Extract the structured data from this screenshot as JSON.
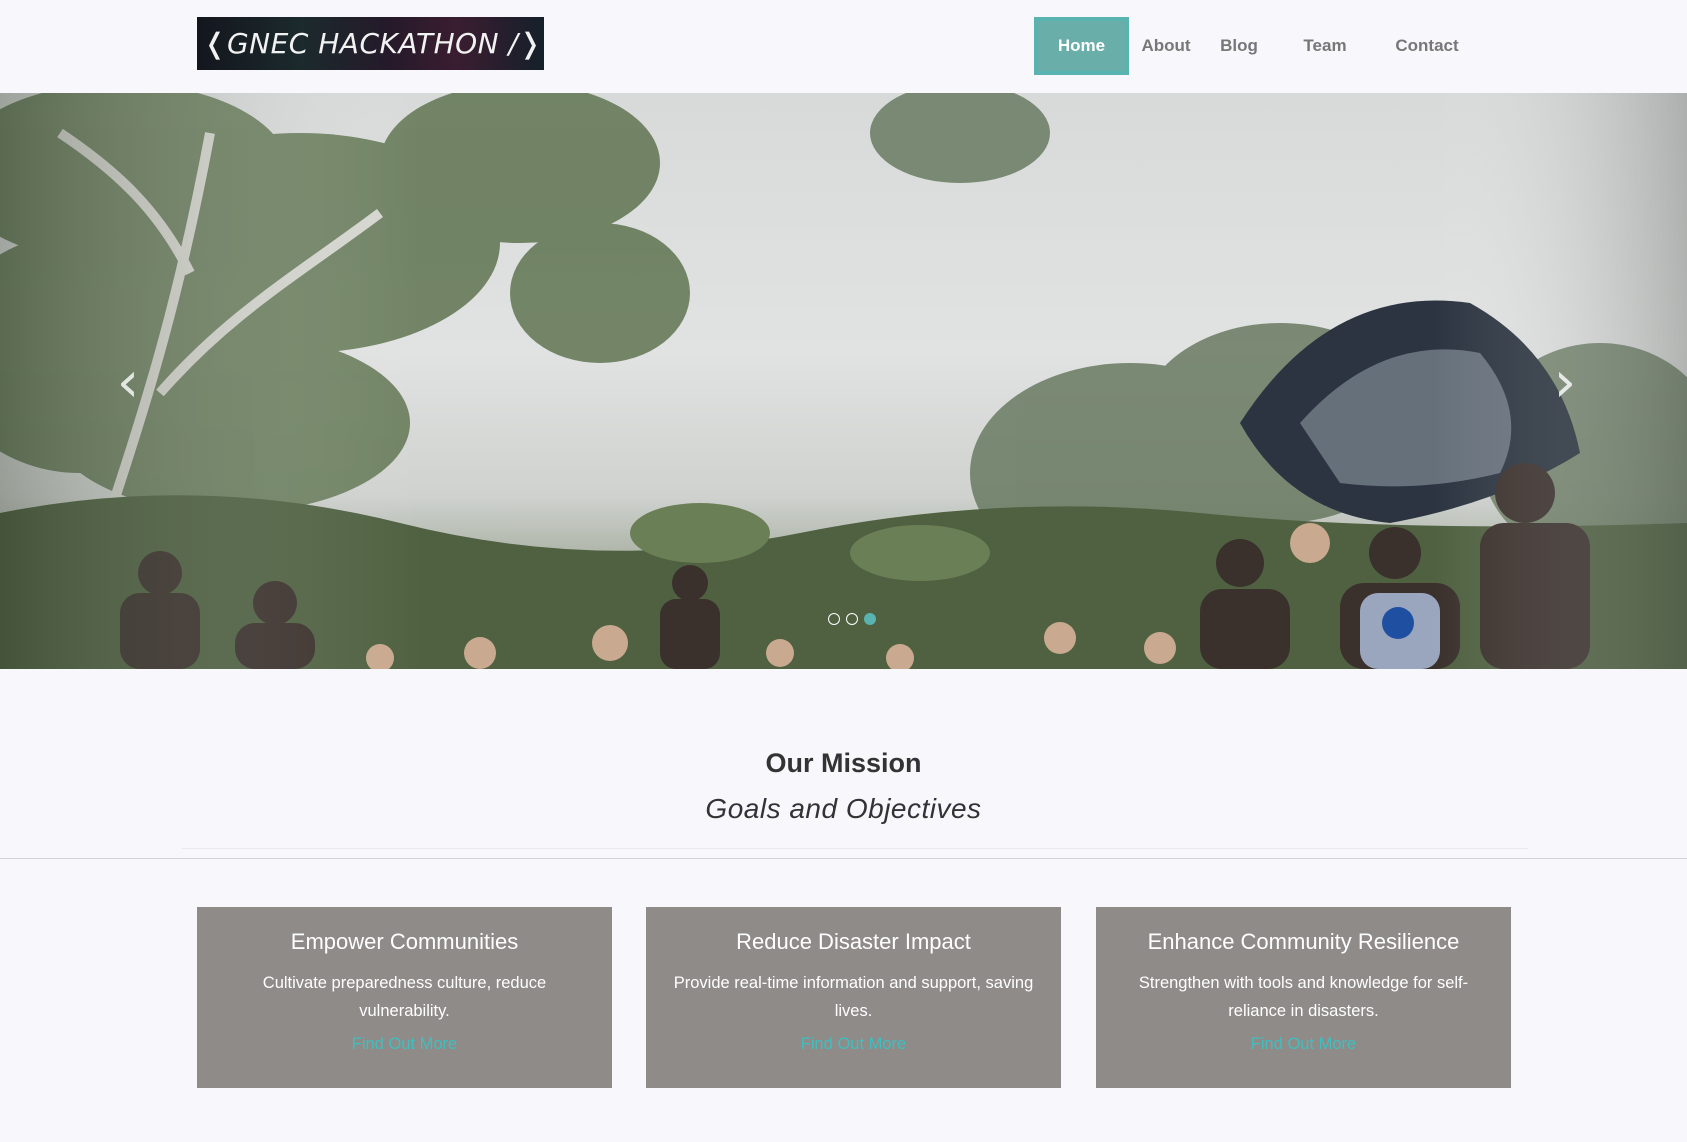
{
  "header": {
    "logo_text": "❬GNEC HACKATHON /❭",
    "nav": [
      {
        "label": "Home",
        "active": true
      },
      {
        "label": "About",
        "active": false
      },
      {
        "label": "Blog",
        "active": false
      },
      {
        "label": "Team",
        "active": false
      },
      {
        "label": "Contact",
        "active": false
      }
    ]
  },
  "hero": {
    "prev_icon": "chevron-left-icon",
    "next_icon": "chevron-right-icon",
    "prev_glyph": "‹",
    "next_glyph": "›",
    "slides": 3,
    "active_slide": 3
  },
  "mission": {
    "title": "Our Mission",
    "subtitle": "Goals and Objectives"
  },
  "cards": [
    {
      "title": "Empower Communities",
      "text": "Cultivate preparedness culture, reduce vulnerability.",
      "link": "Find Out More"
    },
    {
      "title": "Reduce Disaster Impact",
      "text": "Provide real-time information and support, saving lives.",
      "link": "Find Out More"
    },
    {
      "title": "Enhance Community Resilience",
      "text": "Strengthen with tools and knowledge for self-reliance in disasters.",
      "link": "Find Out More"
    }
  ],
  "colors": {
    "accent": "#59b3b0",
    "nav_active_bg": "#6aaeaa",
    "card_bg": "#8e8b89",
    "link": "#3fbfbf",
    "page_bg": "#f8f8fc"
  }
}
